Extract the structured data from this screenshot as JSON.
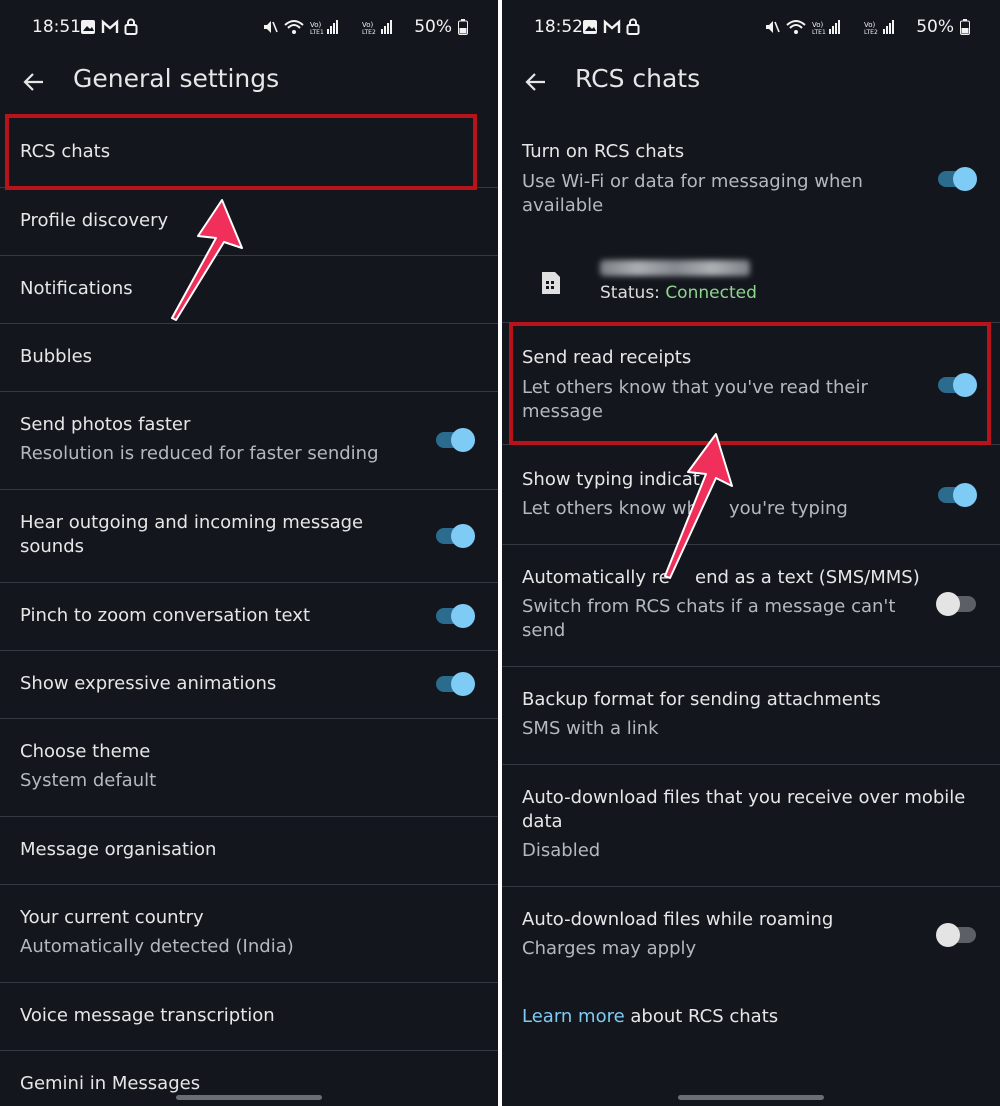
{
  "left": {
    "status_bar": {
      "time": "18:51",
      "battery": "50%"
    },
    "title": "General settings",
    "items": [
      {
        "label": "RCS chats"
      },
      {
        "label": "Profile discovery"
      },
      {
        "label": "Notifications"
      },
      {
        "label": "Bubbles"
      },
      {
        "label": "Send photos faster",
        "sub": "Resolution is reduced for faster sending",
        "toggle": "on"
      },
      {
        "label": "Hear outgoing and incoming message",
        "label2": "sounds",
        "toggle": "on"
      },
      {
        "label": "Pinch to zoom conversation text",
        "toggle": "on"
      },
      {
        "label": "Show expressive animations",
        "toggle": "on"
      },
      {
        "label": "Choose theme",
        "sub": "System default"
      },
      {
        "label": "Message organisation"
      },
      {
        "label": "Your current country",
        "sub": "Automatically detected (India)"
      },
      {
        "label": "Voice message transcription"
      },
      {
        "label": "Gemini in Messages"
      }
    ]
  },
  "right": {
    "status_bar": {
      "time": "18:52",
      "battery": "50%"
    },
    "title": "RCS chats",
    "items": [
      {
        "label": "Turn on RCS chats",
        "sub": "Use Wi-Fi or data for messaging when",
        "sub2": "available",
        "toggle": "on"
      },
      {
        "sim_status_label": "Status:",
        "sim_status_value": "Connected"
      },
      {
        "label": "Send read receipts",
        "sub": "Let others know that you've read their",
        "sub2": "message",
        "toggle": "on"
      },
      {
        "label": "Show typing indicat",
        "sub": "Let others know wh",
        "sub_tail": "you're typing",
        "toggle": "on"
      },
      {
        "label": "Automatically re",
        "label_tail": "end as a text (SMS/MMS)",
        "sub": "Switch from RCS chats if a message can't",
        "sub2": "send",
        "toggle": "off"
      },
      {
        "label": "Backup format for sending attachments",
        "sub": "SMS with a link"
      },
      {
        "label": "Auto-download files that you receive over mobile",
        "label2": "data",
        "sub": "Disabled"
      },
      {
        "label": "Auto-download files while roaming",
        "sub": "Charges may apply",
        "toggle": "off"
      }
    ],
    "footer": {
      "link": "Learn more",
      "rest": " about RCS chats"
    }
  },
  "colors": {
    "background": "#13171d",
    "highlight": "#b8121b",
    "arrow": "#f0305a",
    "toggle_on": "#7ecbf5",
    "connected": "#8fd48f"
  },
  "icons": [
    "back-arrow-icon",
    "gallery-icon",
    "gmail-icon",
    "lock-icon",
    "mute-icon",
    "wifi-icon",
    "signal-icon",
    "battery-icon",
    "sim-card-icon"
  ]
}
